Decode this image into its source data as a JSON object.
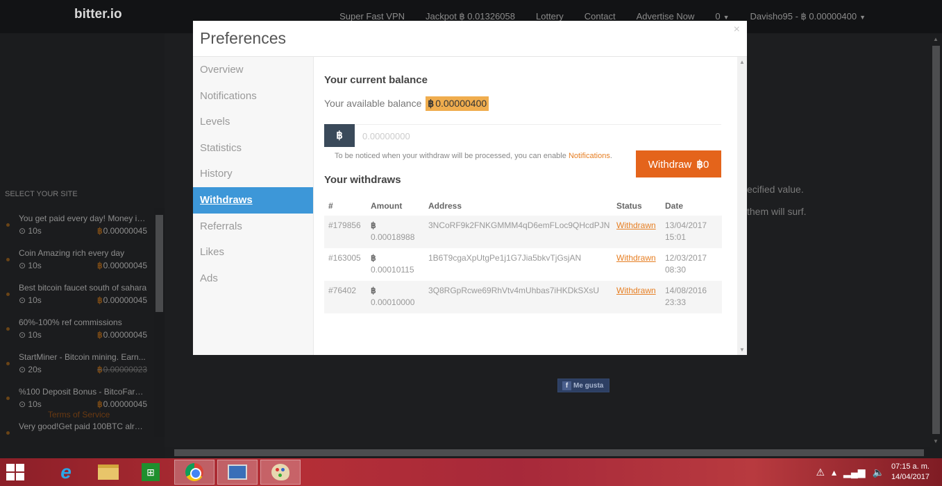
{
  "site": {
    "brand": "bitter.io",
    "nav": [
      "Super Fast VPN",
      "Jackpot ฿ 0.01326058",
      "Lottery",
      "Contact",
      "Advertise Now"
    ],
    "messages_count": "0",
    "user": "Davisho95 - ฿ 0.00000400",
    "bg_text_1": "ecified value.",
    "bg_text_2": "them will surf.",
    "fb_like": "Me gusta"
  },
  "sidebar": {
    "heading": "SELECT YOUR SITE",
    "items": [
      {
        "title": "You get paid every day! Money ins...",
        "time": "10s",
        "amount": "0.00000045",
        "struck": false
      },
      {
        "title": "Coin Amazing rich every day",
        "time": "10s",
        "amount": "0.00000045",
        "struck": false
      },
      {
        "title": "Best bitcoin faucet south of sahara",
        "time": "10s",
        "amount": "0.00000045",
        "struck": false
      },
      {
        "title": "60%-100% ref commissions",
        "time": "10s",
        "amount": "0.00000045",
        "struck": false
      },
      {
        "title": "StartMiner - Bitcoin mining. Earn...",
        "time": "20s",
        "amount": "0.00000023",
        "struck": true
      },
      {
        "title": "%100 Deposit Bonus - BitcoFarm...",
        "time": "10s",
        "amount": "0.00000045",
        "struck": false
      },
      {
        "title": "Very good!Get paid 100BTC alrea...",
        "time": "",
        "amount": "",
        "struck": false
      }
    ],
    "terms": "Terms of Service"
  },
  "modal": {
    "title": "Preferences",
    "close": "×",
    "nav": [
      {
        "label": "Overview",
        "active": false
      },
      {
        "label": "Notifications",
        "active": false
      },
      {
        "label": "Levels",
        "active": false
      },
      {
        "label": "Statistics",
        "active": false
      },
      {
        "label": "History",
        "active": false
      },
      {
        "label": "Withdraws",
        "active": true
      },
      {
        "label": "Referrals",
        "active": false
      },
      {
        "label": "Likes",
        "active": false
      },
      {
        "label": "Ads",
        "active": false
      }
    ],
    "balance_heading": "Your current balance",
    "available_label": "Your available balance",
    "available_value": "0.00000400",
    "btc_symbol": "฿",
    "amount_placeholder": "0.00000000",
    "notice_text": "To be noticed when your withdraw will be processed, you can enable",
    "notice_link": "Notifications",
    "notice_end": ".",
    "withdraw_label": "Withdraw",
    "withdraw_amount": "0",
    "withdraws_heading": "Your withdraws",
    "table": {
      "headers": [
        "#",
        "Amount",
        "Address",
        "Status",
        "Date"
      ],
      "rows": [
        {
          "id": "#179856",
          "amount": "0.00018988",
          "address": "3NCoRF9k2FNKGMMM4qD6emFLoc9QHcdPJN",
          "status": "Withdrawn",
          "date": "13/04/2017",
          "time": "15:01"
        },
        {
          "id": "#163005",
          "amount": "0.00010115",
          "address": "1B6T9cgaXpUtgPe1j1G7Jia5bkvTjGsjAN",
          "status": "Withdrawn",
          "date": "12/03/2017",
          "time": "08:30"
        },
        {
          "id": "#76402",
          "amount": "0.00010000",
          "address": "3Q8RGpRcwe69RhVtv4mUhbas7iHKDkSXsU",
          "status": "Withdrawn",
          "date": "14/08/2016",
          "time": "23:33"
        }
      ]
    }
  },
  "taskbar": {
    "time": "07:15 a. m.",
    "date": "14/04/2017"
  }
}
